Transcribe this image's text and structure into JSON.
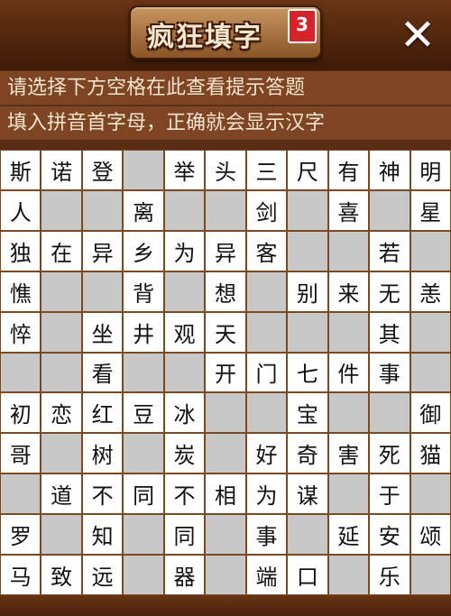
{
  "title": "疯狂填字",
  "level": "3",
  "close_label": "✕",
  "hints": [
    "请选择下方空格在此查看提示答题",
    "填入拼音首字母，正确就会显示汉字"
  ],
  "grid": [
    [
      "斯",
      "诺",
      "登",
      "",
      "举",
      "头",
      "三",
      "尺",
      "有",
      "神",
      "明"
    ],
    [
      "人",
      "",
      "",
      "离",
      "",
      "",
      "剑",
      "",
      "喜",
      "",
      "星"
    ],
    [
      "独",
      "在",
      "异",
      "乡",
      "为",
      "异",
      "客",
      "",
      "",
      "若",
      ""
    ],
    [
      "憔",
      "",
      "",
      "背",
      "",
      "想",
      "",
      "别",
      "来",
      "无",
      "恙"
    ],
    [
      "悴",
      "",
      "坐",
      "井",
      "观",
      "天",
      "",
      "",
      "",
      "其",
      ""
    ],
    [
      "",
      "",
      "看",
      "",
      "",
      "开",
      "门",
      "七",
      "件",
      "事",
      ""
    ],
    [
      "初",
      "恋",
      "红",
      "豆",
      "冰",
      "",
      "",
      "宝",
      "",
      "",
      "御"
    ],
    [
      "哥",
      "",
      "树",
      "",
      "炭",
      "",
      "好",
      "奇",
      "害",
      "死",
      "猫"
    ],
    [
      "",
      "道",
      "不",
      "同",
      "不",
      "相",
      "为",
      "谋",
      "",
      "于",
      ""
    ],
    [
      "罗",
      "",
      "知",
      "",
      "同",
      "",
      "事",
      "",
      "延",
      "安",
      "颂"
    ],
    [
      "马",
      "致",
      "远",
      "",
      "器",
      "",
      "端",
      "口",
      "",
      "乐",
      ""
    ]
  ]
}
